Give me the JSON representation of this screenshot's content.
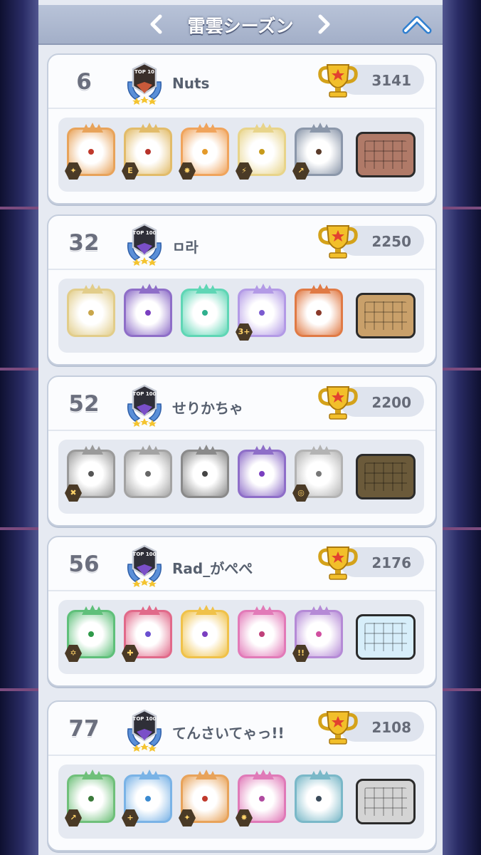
{
  "header": {
    "title": "雷雲シーズン"
  },
  "entries": [
    {
      "rank": "6",
      "badge": "TOP 10",
      "name": "Nuts",
      "trophies": "3141",
      "dice": [
        {
          "icon": "dragon-die-icon",
          "color": "#e8a35a",
          "pip": "#c0392b",
          "badge": "✦"
        },
        {
          "icon": "solar-die-icon",
          "color": "#e2bc6a",
          "pip": "#b7332a",
          "badge": "E"
        },
        {
          "icon": "flame-die-icon",
          "color": "#f0a45c",
          "pip": "#e49a2a",
          "badge": "✸"
        },
        {
          "icon": "shield-die-icon",
          "color": "#e8d48a",
          "pip": "#c79a1a",
          "badge": "⚡"
        },
        {
          "icon": "thunder-die-icon",
          "color": "#8b97aa",
          "pip": "#5a3b2a",
          "badge": "↗"
        }
      ],
      "board": {
        "icon": "arena-board-icon",
        "color": "#b07a68"
      }
    },
    {
      "rank": "32",
      "badge": "TOP 100",
      "name": "ㅁ라",
      "trophies": "2250",
      "dice": [
        {
          "icon": "holy-die-icon",
          "color": "#e2cd8a",
          "pip": "#c9a64a",
          "badge": ""
        },
        {
          "icon": "blade-die-icon",
          "color": "#8e6ec8",
          "pip": "#7a3fc0",
          "badge": ""
        },
        {
          "icon": "wind-die-icon",
          "color": "#5fd6b5",
          "pip": "#2fb08e",
          "badge": ""
        },
        {
          "icon": "cycle-die-icon",
          "color": "#b39ae6",
          "pip": "#7b5bd0",
          "badge": "3+"
        },
        {
          "icon": "volcano-die-icon",
          "color": "#e07a45",
          "pip": "#8a3a2a",
          "badge": ""
        }
      ],
      "board": {
        "icon": "desert-board-icon",
        "color": "#c9a06a"
      }
    },
    {
      "rank": "52",
      "badge": "TOP 100",
      "name": "せりかちゃ",
      "trophies": "2200",
      "dice": [
        {
          "icon": "skull-die-icon",
          "color": "#9a9a9a",
          "pip": "#555555",
          "badge": "✖"
        },
        {
          "icon": "gear-die-icon",
          "color": "#a3a3a3",
          "pip": "#666666",
          "badge": ""
        },
        {
          "icon": "scythe-die-icon",
          "color": "#8a8a8a",
          "pip": "#444444",
          "badge": ""
        },
        {
          "icon": "blade-die-icon",
          "color": "#8e6ec8",
          "pip": "#7a3fc0",
          "badge": ""
        },
        {
          "icon": "time-die-icon",
          "color": "#b3b3b3",
          "pip": "#777777",
          "badge": "◎"
        }
      ],
      "board": {
        "icon": "volcanic-board-icon",
        "color": "#6b5a3a"
      }
    },
    {
      "rank": "56",
      "badge": "TOP 100",
      "name": "Rad_がぺぺ",
      "trophies": "2176",
      "dice": [
        {
          "icon": "plant-die-icon",
          "color": "#5fc07a",
          "pip": "#2f9a4a",
          "badge": "✡"
        },
        {
          "icon": "infinity-die-icon",
          "color": "#e16a8a",
          "pip": "#6a4fd0",
          "badge": "✚"
        },
        {
          "icon": "rainbow-die-icon",
          "color": "#f0c24a",
          "pip": "#7a3fc0",
          "badge": ""
        },
        {
          "icon": "sword-die-icon",
          "color": "#e27ab8",
          "pip": "#c0407a",
          "badge": ""
        },
        {
          "icon": "combo-die-icon",
          "color": "#b58ad6",
          "pip": "#d14fa0",
          "badge": "!!"
        }
      ],
      "board": {
        "icon": "cloud-board-icon",
        "color": "#d7eefa"
      }
    },
    {
      "rank": "77",
      "badge": "TOP 100",
      "name": "てんさいてゃっ!!",
      "trophies": "2108",
      "dice": [
        {
          "icon": "tree-die-icon",
          "color": "#6fc07a",
          "pip": "#3a7a3a",
          "badge": "↗"
        },
        {
          "icon": "ice-die-icon",
          "color": "#7ab3e6",
          "pip": "#3a8ad0",
          "badge": "+"
        },
        {
          "icon": "dragon-die-icon",
          "color": "#e8a35a",
          "pip": "#c0392b",
          "badge": "✦"
        },
        {
          "icon": "spiral-die-icon",
          "color": "#e07ab8",
          "pip": "#b04aa0",
          "badge": "✸"
        },
        {
          "icon": "paper-die-icon",
          "color": "#7ab8c8",
          "pip": "#3a4a5a",
          "badge": ""
        }
      ],
      "board": {
        "icon": "stone-board-icon",
        "color": "#d4d4d4"
      }
    }
  ]
}
